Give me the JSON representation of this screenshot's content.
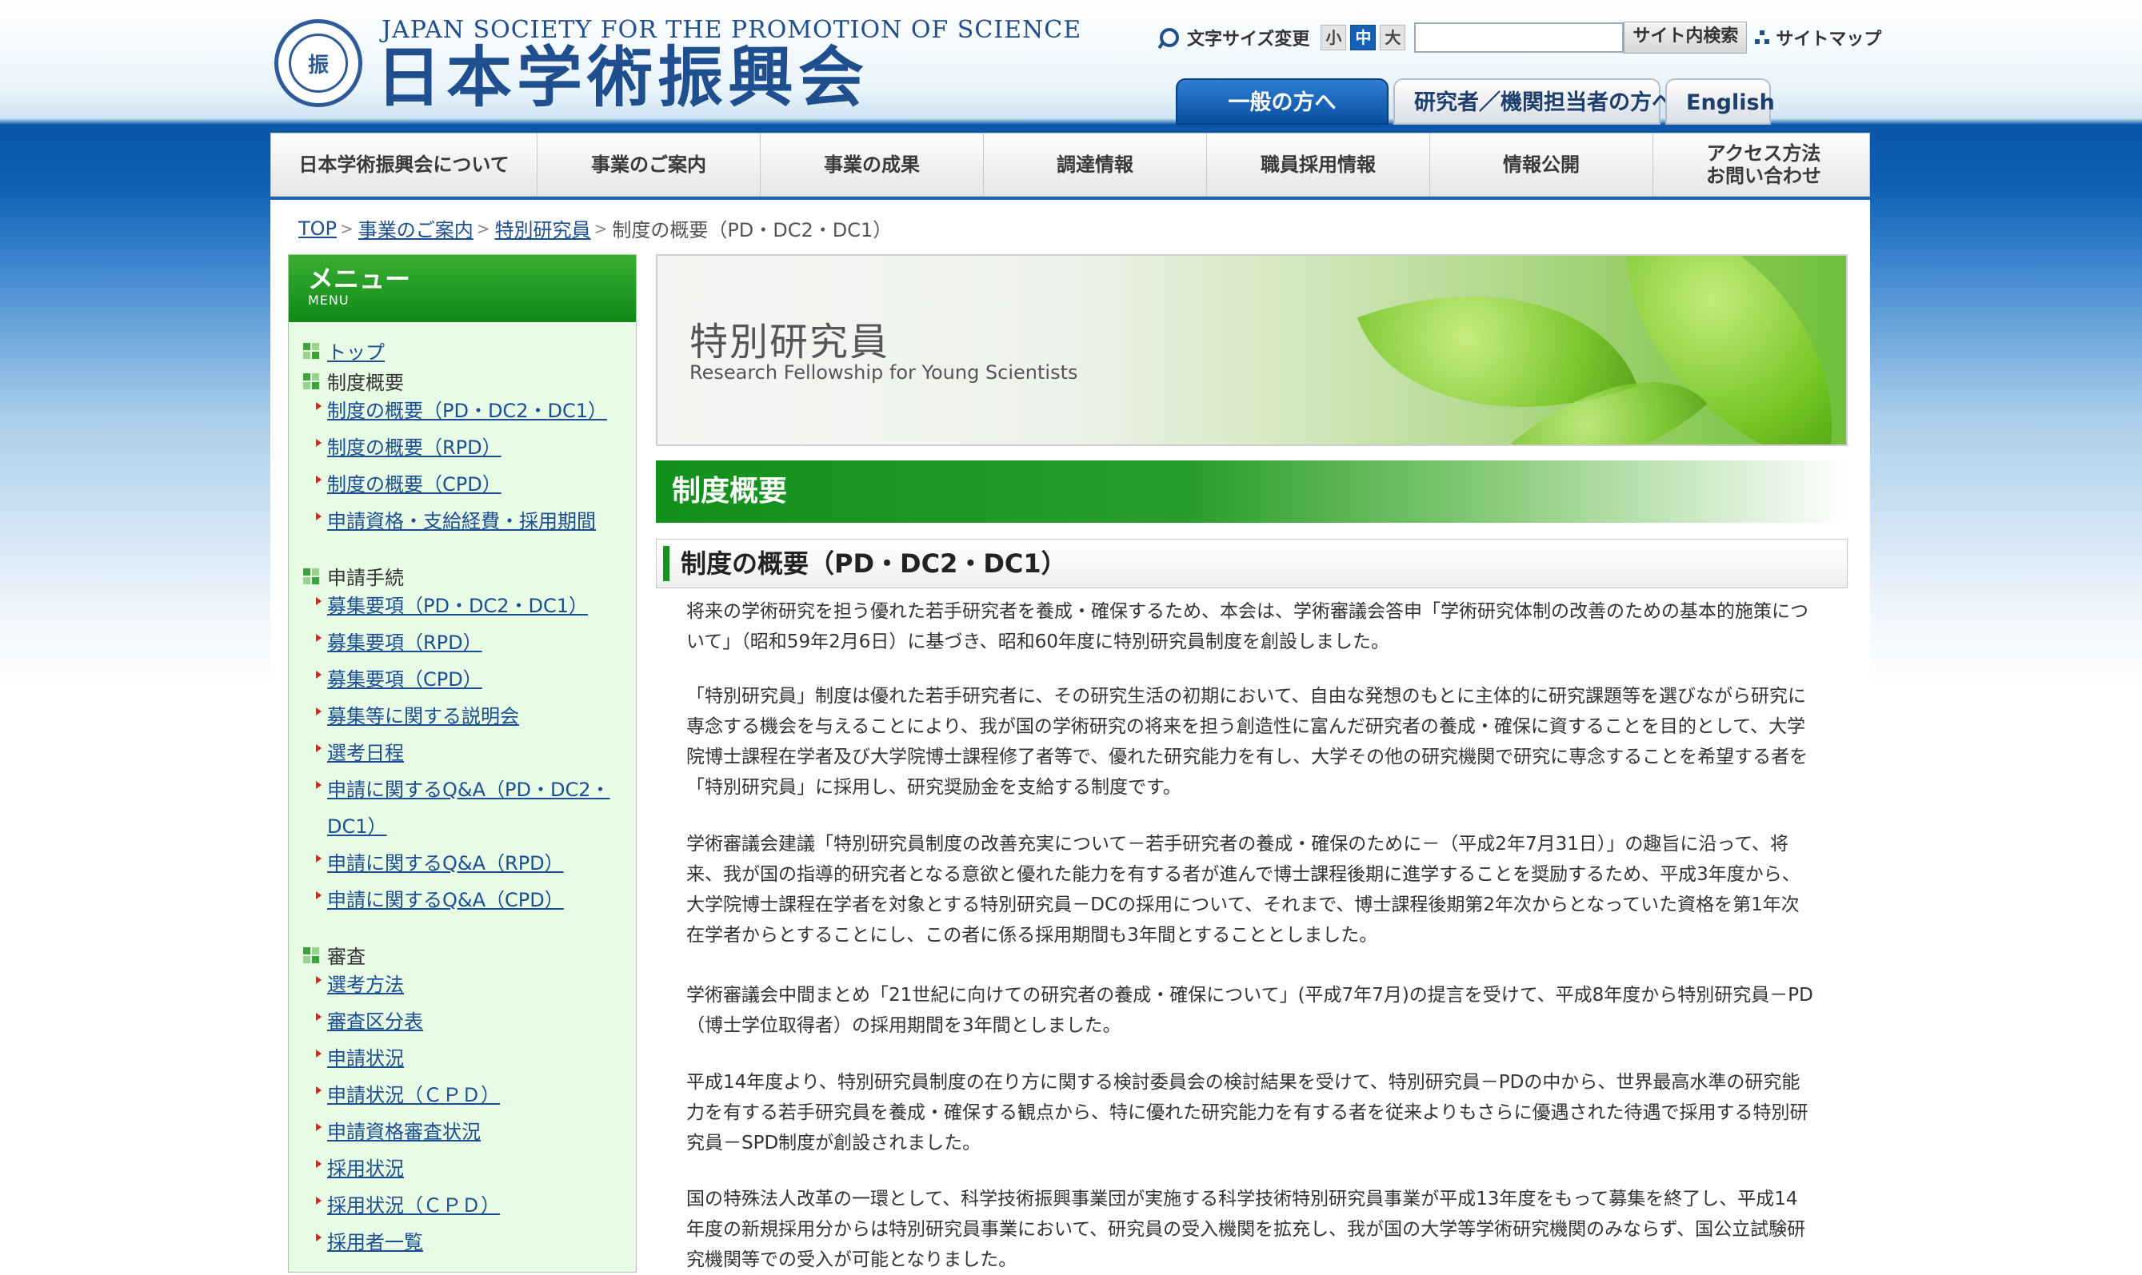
{
  "header": {
    "logo_en": "JAPAN SOCIETY FOR THE PROMOTION OF SCIENCE",
    "logo_ja": "日本学術振興会",
    "seal_mark": "振"
  },
  "utility": {
    "font_size_label": "文字サイズ変更",
    "font_sizes": [
      "小",
      "中",
      "大"
    ],
    "active_font_size": "中",
    "search_value": "",
    "search_button": "サイト内検索",
    "sitemap": "サイトマップ"
  },
  "audience_tabs": {
    "general": "一般の方へ",
    "researcher": "研究者／機関担当者の方へ",
    "english": "English"
  },
  "global_nav": [
    "日本学術振興会について",
    "事業のご案内",
    "事業の成果",
    "調達情報",
    "職員採用情報",
    "情報公開",
    "アクセス方法",
    "お問い合わせ"
  ],
  "breadcrumb": {
    "items": [
      "TOP",
      "事業のご案内",
      "特別研究員"
    ],
    "current": "制度の概要（PD・DC2・DC1）"
  },
  "sidebar": {
    "title": "メニュー",
    "title_en": "MENU",
    "top": "トップ",
    "groups": {
      "overview": "制度概要",
      "application": "申請手続",
      "review": "審査"
    },
    "overview_links": [
      "制度の概要（PD・DC2・DC1）",
      "制度の概要（RPD）",
      "制度の概要（CPD）",
      "申請資格・支給経費・採用期間"
    ],
    "application_links": [
      "募集要項（PD・DC2・DC1）",
      "募集要項（RPD）",
      "募集要項（CPD）",
      "募集等に関する説明会",
      "選考日程",
      "申請に関するQ&A（PD・DC2・",
      "DC1）",
      "申請に関するQ&A（RPD）",
      "申請に関するQ&A（CPD）"
    ],
    "review_links": [
      "選考方法",
      "審査区分表",
      "申請状況",
      "申請状況（ＣＰＤ）",
      "申請資格審査状況",
      "採用状況",
      "採用状況（ＣＰＤ）",
      "採用者一覧"
    ]
  },
  "hero": {
    "title": "特別研究員",
    "subtitle": "Research Fellowship for Young Scientists"
  },
  "main": {
    "section_title": "制度概要",
    "subsection_title": "制度の概要（PD・DC2・DC1）",
    "paragraphs": [
      "将来の学術研究を担う優れた若手研究者を養成・確保するため、本会は、学術審議会答申「学術研究体制の改善のための基本的施策について」（昭和59年2月6日）に基づき、昭和60年度に特別研究員制度を創設しました。",
      "「特別研究員」制度は優れた若手研究者に、その研究生活の初期において、自由な発想のもとに主体的に研究課題等を選びながら研究に専念する機会を与えることにより、我が国の学術研究の将来を担う創造性に富んだ研究者の養成・確保に資することを目的として、大学院博士課程在学者及び大学院博士課程修了者等で、優れた研究能力を有し、大学その他の研究機関で研究に専念することを希望する者を「特別研究員」に採用し、研究奨励金を支給する制度です。",
      "学術審議会建議「特別研究員制度の改善充実について－若手研究者の養成・確保のために－（平成2年7月31日）」の趣旨に沿って、将来、我が国の指導的研究者となる意欲と優れた能力を有する者が進んで博士課程後期に進学することを奨励するため、平成3年度から、大学院博士課程在学者を対象とする特別研究員－DCの採用について、それまで、博士課程後期第2年次からとなっていた資格を第1年次在学者からとすることにし、この者に係る採用期間も3年間とすることとしました。",
      "学術審議会中間まとめ「21世紀に向けての研究者の養成・確保について」(平成7年7月)の提言を受けて、平成8年度から特別研究員－PD（博士学位取得者）の採用期間を3年間としました。",
      "平成14年度より、特別研究員制度の在り方に関する検討委員会の検討結果を受けて、特別研究員－PDの中から、世界最高水準の研究能力を有する若手研究員を養成・確保する観点から、特に優れた研究能力を有する者を従来よりもさらに優遇された待遇で採用する特別研究員－SPD制度が創設されました。",
      "国の特殊法人改革の一環として、科学技術振興事業団が実施する科学技術特別研究員事業が平成13年度をもって募集を終了し、平成14年度の新規採用分からは特別研究員事業において、研究員の受入機関を拡充し、我が国の大学等学術研究機関のみならず、国公立試験研究機関等での受入が可能となりました。"
    ]
  },
  "colors": {
    "brand_blue": "#1f4f8f",
    "accent_green": "#13921f",
    "link": "#1b4f94",
    "sidebar_bg": "#e8fbe5"
  },
  "icons": [
    "search-icon",
    "sitemap-icon",
    "menu-square-icon",
    "red-arrow-bullet-icon"
  ]
}
